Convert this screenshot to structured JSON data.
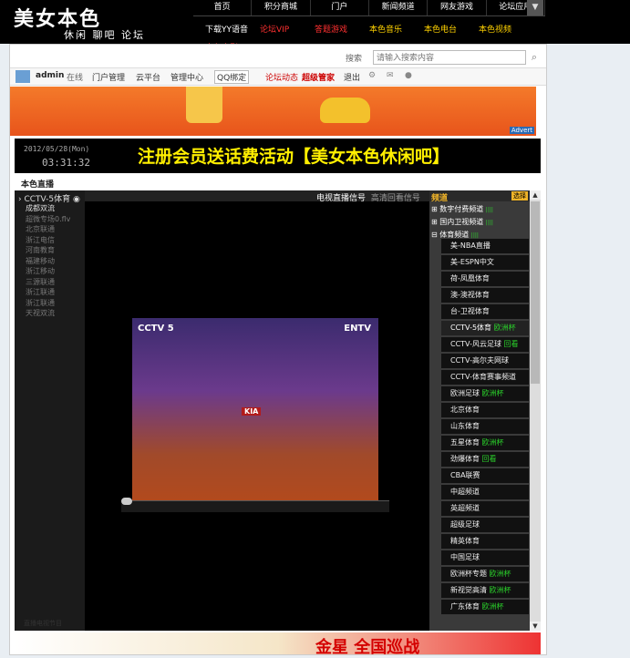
{
  "site": {
    "logo": "美女本色",
    "tagline": "休闲 聊吧 论坛"
  },
  "nav_primary": [
    "首页",
    "积分商城",
    "门户",
    "新闻频道",
    "网友游戏",
    "论坛应用"
  ],
  "nav_secondary": [
    "下载YY语音",
    "论坛VIP",
    "答题游戏",
    "本色音乐",
    "本色电台",
    "本色视频",
    "本色电影"
  ],
  "search": {
    "label": "搜索",
    "placeholder": "请输入搜索内容"
  },
  "userbar": {
    "username": "admin",
    "status": "在线",
    "items": [
      "门户管理",
      "云平台",
      "管理中心"
    ],
    "qq_button": "QQ绑定",
    "dynamic": "论坛动态",
    "role": "超级管家",
    "logout": "退出"
  },
  "banner": {
    "advert": "Advert"
  },
  "promo": {
    "clock": "2012/05/28(Mon)",
    "time": "03:31:32",
    "text": "注册会员送话费活动【美女本色休闲吧】"
  },
  "section_title": "本色直播",
  "tv": {
    "current_channel": "CCTV-5体育",
    "left_list": [
      "成都双流",
      "超微专场0.flv",
      "北京联通",
      "浙江电信",
      "河南教育",
      "福建移动",
      "浙江移动",
      "三源联通",
      "浙江联通",
      "浙江联通",
      "天视双流"
    ],
    "tab_live": "电视直播信号",
    "tab_replay": "高清回看信号",
    "video_logo_left": "CCTV 5",
    "video_logo_right": "ENTV",
    "video_sponsor": "KIA",
    "footer": "直播电视节目",
    "category_title": "频道",
    "category_button": "选择",
    "groups": [
      {
        "name": "数字付费频道",
        "badge": "||||"
      },
      {
        "name": "国内卫视频道",
        "badge": "||||"
      },
      {
        "name": "体育频道",
        "badge": "||||"
      }
    ],
    "channels": [
      {
        "name": "美-NBA直播",
        "badge": ""
      },
      {
        "name": "美-ESPN中文",
        "badge": ""
      },
      {
        "name": "荷-凤凰体育",
        "badge": ""
      },
      {
        "name": "澳-澳视体育",
        "badge": ""
      },
      {
        "name": "台-卫视体育",
        "badge": ""
      },
      {
        "name": "CCTV-5体育",
        "badge": "欧洲杯"
      },
      {
        "name": "CCTV-风云足球",
        "badge": "回看"
      },
      {
        "name": "CCTV-高尔夫网球",
        "badge": ""
      },
      {
        "name": "CCTV-体育赛事频道",
        "badge": ""
      },
      {
        "name": "欧洲足球",
        "badge": "欧洲杯"
      },
      {
        "name": "北京体育",
        "badge": ""
      },
      {
        "name": "山东体育",
        "badge": ""
      },
      {
        "name": "五星体育",
        "badge": "欧洲杯"
      },
      {
        "name": "劲爆体育",
        "badge": "回看"
      },
      {
        "name": "CBA联赛",
        "badge": ""
      },
      {
        "name": "中超频道",
        "badge": ""
      },
      {
        "name": "英超频道",
        "badge": ""
      },
      {
        "name": "超级足球",
        "badge": ""
      },
      {
        "name": "精英体育",
        "badge": ""
      },
      {
        "name": "中国足球",
        "badge": ""
      },
      {
        "name": "欧洲杯专题",
        "badge": "欧洲杯"
      },
      {
        "name": "新视觉高清",
        "badge": "欧洲杯"
      },
      {
        "name": "广东体育",
        "badge": "欧洲杯"
      }
    ]
  },
  "bottom_banner": {
    "text": "金星 全国巡战"
  }
}
